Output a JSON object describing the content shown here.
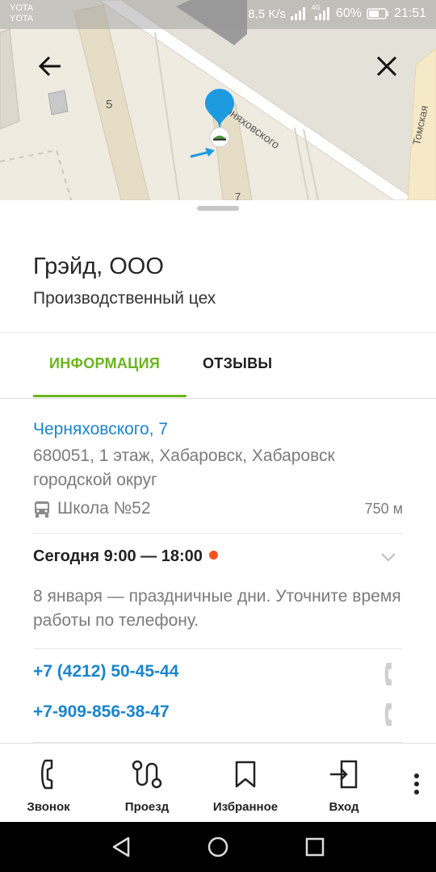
{
  "status_bar": {
    "carrier_1": "YOTA",
    "carrier_2": "YOTA",
    "net_speed": "8,5 K/s",
    "network_type": "4G",
    "battery": "60%",
    "time": "21:51"
  },
  "map": {
    "street_label": "Черняховского",
    "cross_street_label": "Томская",
    "house_number_left": "5",
    "house_number_bottom": "7",
    "accent_color": "#1e9be0",
    "pin_icon": "location-pin-icon"
  },
  "sheet": {
    "org_name": "Грэйд, ООО",
    "org_category": "Производственный цех",
    "tabs": [
      {
        "label": "ИНФОРМАЦИЯ",
        "active": true
      },
      {
        "label": "ОТЗЫВЫ",
        "active": false
      }
    ],
    "address": {
      "street": "Черняховского, 7",
      "detail": "680051, 1 этаж, Хабаровск, Хабаровск городской округ"
    },
    "transit": {
      "icon": "bus-icon",
      "stop": "Школа №52",
      "distance": "750 м"
    },
    "hours": {
      "today": "Сегодня 9:00 — 18:00",
      "status_color": "#f4531f",
      "note": "8 января — праздничные дни. Уточните время работы по телефону."
    },
    "phones": [
      "+7 (4212) 50-45-44",
      "+7-909-856-38-47"
    ]
  },
  "toolbar": {
    "items": [
      {
        "label": "Звонок",
        "icon": "phone-icon"
      },
      {
        "label": "Проезд",
        "icon": "route-icon"
      },
      {
        "label": "Избранное",
        "icon": "bookmark-icon"
      },
      {
        "label": "Вход",
        "icon": "entrance-icon"
      }
    ]
  },
  "colors": {
    "green_accent": "#6ab41f",
    "link_blue": "#1b84cc"
  }
}
